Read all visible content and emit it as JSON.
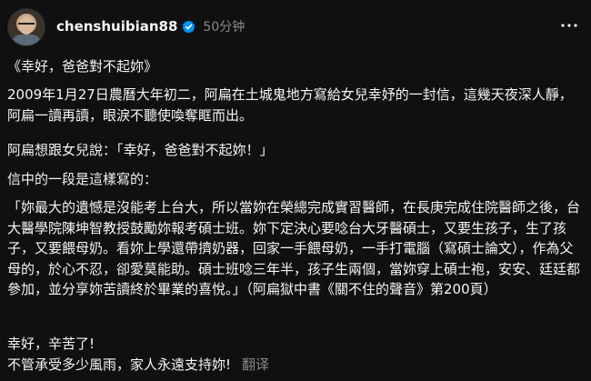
{
  "post": {
    "username": "chenshuibian88",
    "timestamp": "50分钟",
    "verified_color": "#0095f6",
    "paragraphs": {
      "p1": "《幸好，爸爸對不起妳》",
      "p2": "2009年1月27日農曆大年初二，阿扁在土城鬼地方寫給女兒幸妤的一封信，這幾天夜深人靜，阿扁一讀再讀，眼淚不聽使喚奪眶而出。",
      "p3": "阿扁想跟女兒說：「幸好，爸爸對不起妳！」",
      "p4": "信中的一段是這樣寫的：",
      "p5": "「妳最大的遺憾是沒能考上台大，所以當妳在榮總完成實習醫師，在長庚完成住院醫師之後，台大醫學院陳坤智教授鼓勵妳報考碩士班。妳下定決心要唸台大牙醫碩士，又要生孩子，生了孩子，又要餵母奶。看妳上學還帶擠奶器，回家一手餵母奶，一手打電腦（寫碩士論文），作為父母的，於心不忍，卻愛莫能助。碩士班唸三年半，孩子生兩個，當妳穿上碩士袍，安安、廷廷都參加，並分享妳苦讀終於畢業的喜悅。」（阿扁獄中書《關不住的聲音》第200頁）",
      "p6_line1": "幸好，辛苦了!",
      "p6_line2": "不管承受多少風雨，家人永遠支持妳!"
    },
    "translate_label": "翻译"
  },
  "icons": {
    "avatar": "avatar-photo",
    "verified": "verified-badge-icon",
    "more": "more-horizontal-icon"
  }
}
